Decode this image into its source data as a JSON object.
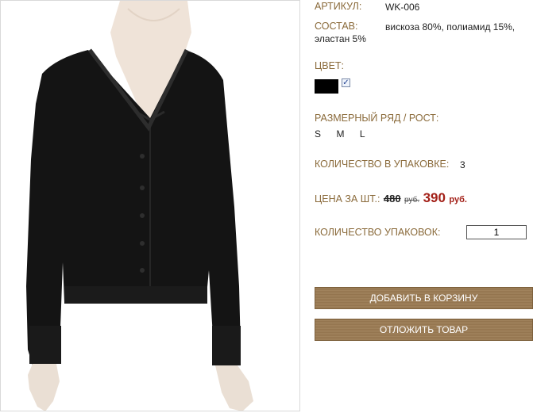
{
  "product": {
    "article_label": "АРТИКУЛ:",
    "article_value": "WK-006",
    "composition_label": "СОСТАВ:",
    "composition_line1": "вискоза 80%, полиамид 15%,",
    "composition_line2": "эластан 5%",
    "color_label": "ЦВЕТ:",
    "color_swatch": "#000000",
    "color_checked": "✓",
    "size_label": "РАЗМЕРНЫЙ РЯД / РОСТ:",
    "sizes": [
      "S",
      "M",
      "L"
    ],
    "pack_qty_label": "КОЛИЧЕСТВО В УПАКОВКЕ:",
    "pack_qty_value": "3",
    "price_label": "ЦЕНА ЗА ШТ.:",
    "old_price": "480",
    "old_currency": "руб.",
    "new_price": "390",
    "new_currency": "руб.",
    "packs_label": "КОЛИЧЕСТВО УПАКОВОК:",
    "packs_value": "1"
  },
  "actions": {
    "add_to_cart": "ДОБАВИТЬ В КОРЗИНУ",
    "postpone": "ОТЛОЖИТЬ ТОВАР"
  },
  "colors": {
    "label": "#8a6a3a",
    "button": "#9a7a52",
    "new_price": "#a32018"
  }
}
